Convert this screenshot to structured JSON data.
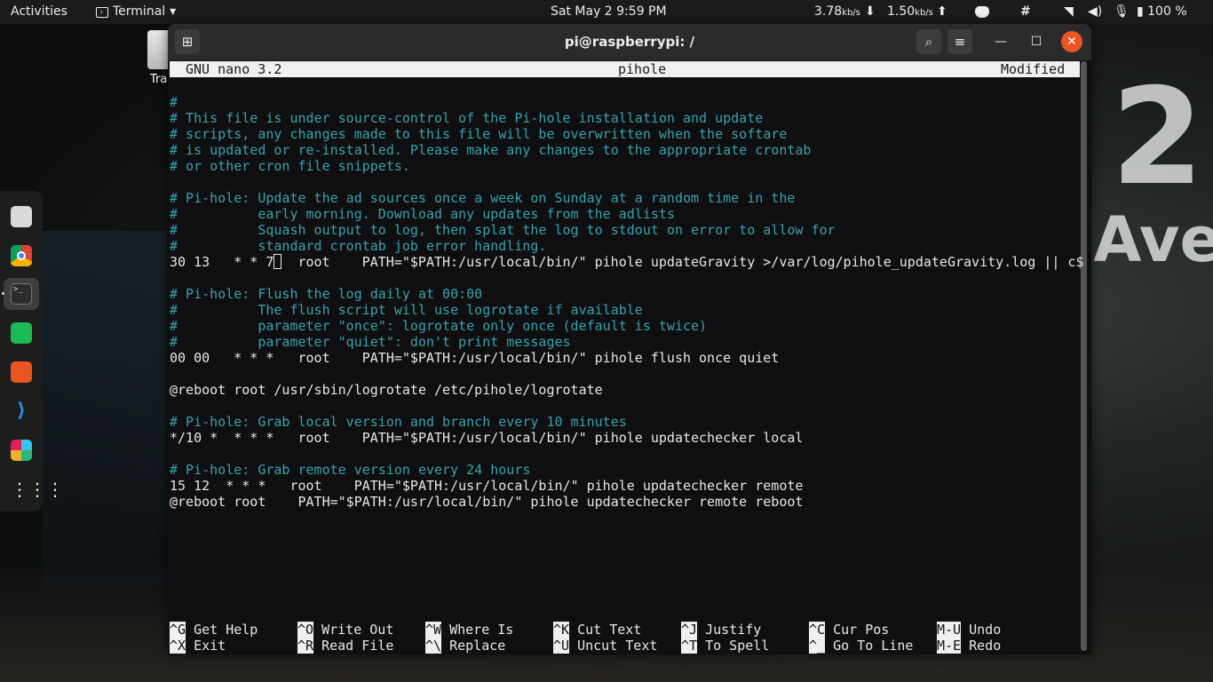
{
  "topbar": {
    "activities": "Activities",
    "app": "Terminal",
    "app_caret": "▾",
    "clock": "Sat May 2  9:59 PM",
    "down_rate": "3.78",
    "down_unit": "kb/s",
    "down_arrow": "⬇",
    "up_rate": "1.50",
    "up_unit": "kb/s",
    "up_arrow": "⬆",
    "slack_glyph": "#",
    "wifi_glyph": "◥",
    "volume_glyph": "◀)",
    "mic_glyph": "🎙",
    "battery": "▮ 100 %"
  },
  "desktop": {
    "trash_label": "Trash"
  },
  "dock": {
    "terminal_glyph": ">_",
    "vscode_glyph": "⟩",
    "apps_glyph": "⋮⋮⋮"
  },
  "window": {
    "title": "pi@raspberrypi: /",
    "newtab_glyph": "⊞",
    "search_glyph": "⌕",
    "menu_glyph": "≡",
    "min_glyph": "—",
    "max_glyph": "☐",
    "close_glyph": "✕"
  },
  "nano": {
    "version": "GNU nano 3.2",
    "filename": "pihole",
    "status": "Modified"
  },
  "lines": [
    {
      "t": "#",
      "c": true
    },
    {
      "t": "# This file is under source-control of the Pi-hole installation and update",
      "c": true
    },
    {
      "t": "# scripts, any changes made to this file will be overwritten when the softare",
      "c": true
    },
    {
      "t": "# is updated or re-installed. Please make any changes to the appropriate crontab",
      "c": true
    },
    {
      "t": "# or other cron file snippets.",
      "c": true
    },
    {
      "t": "",
      "c": false
    },
    {
      "t": "# Pi-hole: Update the ad sources once a week on Sunday at a random time in the",
      "c": true
    },
    {
      "t": "#          early morning. Download any updates from the adlists",
      "c": true
    },
    {
      "t": "#          Squash output to log, then splat the log to stdout on error to allow for",
      "c": true
    },
    {
      "t": "#          standard crontab job error handling.",
      "c": true
    },
    {
      "t": "30 13   * * 7",
      "c": false,
      "cursor": true,
      "rest": "  root    PATH=\"$PATH:/usr/local/bin/\" pihole updateGravity >/var/log/pihole_updateGravity.log || c$"
    },
    {
      "t": "",
      "c": false
    },
    {
      "t": "# Pi-hole: Flush the log daily at 00:00",
      "c": true
    },
    {
      "t": "#          The flush script will use logrotate if available",
      "c": true
    },
    {
      "t": "#          parameter \"once\": logrotate only once (default is twice)",
      "c": true
    },
    {
      "t": "#          parameter \"quiet\": don't print messages",
      "c": true
    },
    {
      "t": "00 00   * * *   root    PATH=\"$PATH:/usr/local/bin/\" pihole flush once quiet",
      "c": false
    },
    {
      "t": "",
      "c": false
    },
    {
      "t": "@reboot root /usr/sbin/logrotate /etc/pihole/logrotate",
      "c": false
    },
    {
      "t": "",
      "c": false
    },
    {
      "t": "# Pi-hole: Grab local version and branch every 10 minutes",
      "c": true
    },
    {
      "t": "*/10 *  * * *   root    PATH=\"$PATH:/usr/local/bin/\" pihole updatechecker local",
      "c": false
    },
    {
      "t": "",
      "c": false
    },
    {
      "t": "# Pi-hole: Grab remote version every 24 hours",
      "c": true
    },
    {
      "t": "15 12  * * *   root    PATH=\"$PATH:/usr/local/bin/\" pihole updatechecker remote",
      "c": false
    },
    {
      "t": "@reboot root    PATH=\"$PATH:/usr/local/bin/\" pihole updatechecker remote reboot",
      "c": false
    }
  ],
  "shortcuts": [
    {
      "key": "^G",
      "label": "Get Help"
    },
    {
      "key": "^O",
      "label": "Write Out"
    },
    {
      "key": "^W",
      "label": "Where Is"
    },
    {
      "key": "^K",
      "label": "Cut Text"
    },
    {
      "key": "^J",
      "label": "Justify"
    },
    {
      "key": "^C",
      "label": "Cur Pos"
    },
    {
      "key": "M-U",
      "label": "Undo"
    },
    {
      "key": "^X",
      "label": "Exit"
    },
    {
      "key": "^R",
      "label": "Read File"
    },
    {
      "key": "^\\",
      "label": "Replace"
    },
    {
      "key": "^U",
      "label": "Uncut Text"
    },
    {
      "key": "^T",
      "label": "To Spell"
    },
    {
      "key": "^_",
      "label": "Go To Line"
    },
    {
      "key": "M-E",
      "label": "Redo"
    }
  ]
}
